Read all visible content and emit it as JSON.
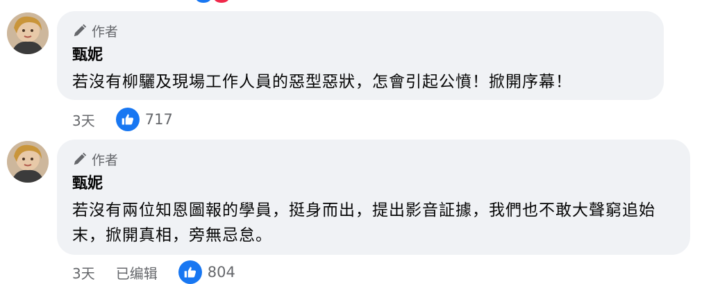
{
  "comments": [
    {
      "badge_label": "作者",
      "author_name": "甄妮",
      "text": "若沒有柳驪及現場工作人員的惡型惡狀，怎會引起公憤！掀開序幕！",
      "time": "3天",
      "edited_label": "",
      "like_count": "717",
      "icons": {
        "badge": "pen-icon",
        "reaction": "thumbs-up-icon"
      }
    },
    {
      "badge_label": "作者",
      "author_name": "甄妮",
      "text": "若沒有兩位知恩圖報的學員，挺身而出，提出影音証據，我們也不敢大聲窮追始末，掀開真相，旁無忌怠。",
      "time": "3天",
      "edited_label": "已编辑",
      "like_count": "804",
      "icons": {
        "badge": "pen-icon",
        "reaction": "thumbs-up-icon"
      }
    }
  ],
  "colors": {
    "bubble_bg": "#f0f2f5",
    "secondary_text": "#65676b",
    "like_blue": "#1877f2",
    "love_red": "#f0284a"
  }
}
